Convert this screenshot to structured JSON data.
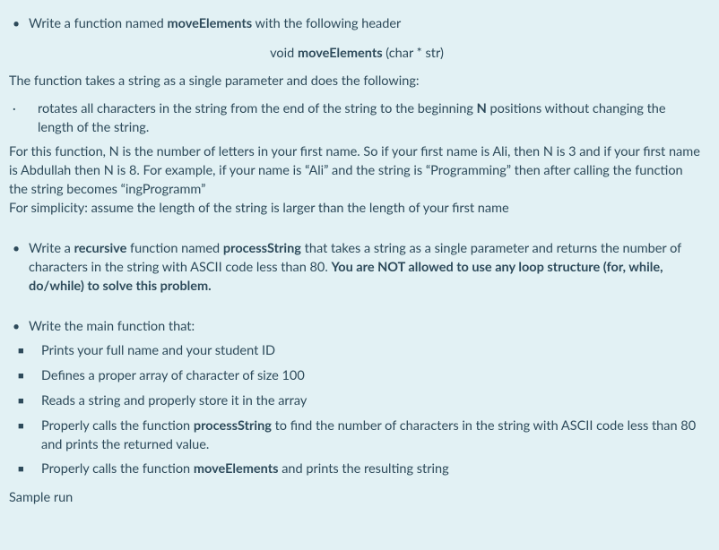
{
  "q1": {
    "lead": "Write a function named ",
    "fn": "moveElements",
    "trail": " with the following header"
  },
  "sig": {
    "ret": "void ",
    "fn": "moveElements",
    "args": "  (char * str)"
  },
  "q1_desc": "The function takes a string as a single parameter and does the following:",
  "q1_rot": {
    "a": "rotates all characters in the string from the end of the string to the beginning ",
    "b": "N",
    "c": "  positions without changing the length of the string."
  },
  "q1_ex1": "For this function, N is the number of letters in your first name. So if your first name is Ali, then N is 3 and if your first name is  Abdullah then N is 8. For example, if your name is “Ali”  and the string is “Programming” then after calling  the function the string becomes “ingProgramm”",
  "q1_ex2": "For simplicity: assume the length of the string is larger than the length of your first name",
  "q2": {
    "a": "Write a ",
    "b": "recursive",
    "c": " function named ",
    "d": "processString",
    "e": " that takes a string as a single parameter and returns the number of characters in the string with ASCII code less than 80. ",
    "f": "You are NOT allowed to use any loop structure (for, while, do/while) to solve this problem."
  },
  "q3": {
    "lead": "Write the main function that:",
    "items": [
      {
        "t": "Prints your full name and your student ID"
      },
      {
        "t": "Defines a proper array of character of size 100"
      },
      {
        "t": "Reads a string and properly store it in the array"
      },
      {
        "a": "Properly calls the function ",
        "b": "processString",
        "c": "  to find the number of characters in the string with ASCII code less than 80 and prints the returned value."
      },
      {
        "a": "Properly calls the function ",
        "b": "moveElements",
        "c": "  and prints the resulting string"
      }
    ]
  },
  "sample": "Sample run"
}
